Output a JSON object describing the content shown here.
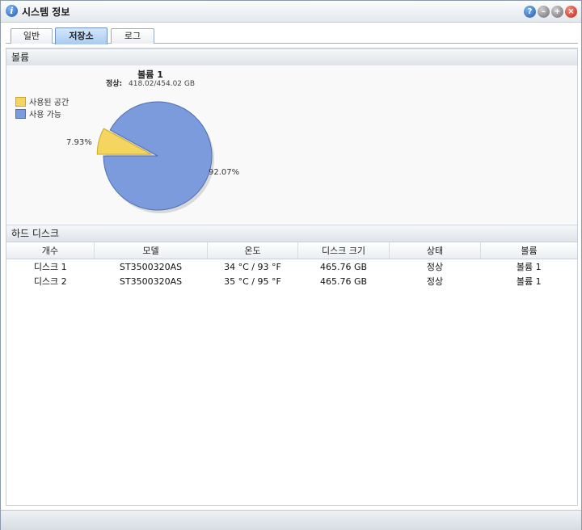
{
  "window": {
    "title": "시스템 정보"
  },
  "tabs": [
    {
      "label": "일반"
    },
    {
      "label": "저장소"
    },
    {
      "label": "로그"
    }
  ],
  "volume_section": {
    "header": "볼륨",
    "volume_title": "볼륨 1",
    "status_label": "정상:",
    "status_value": "418.02/454.02 GB",
    "legend": [
      {
        "label": "사용된 공간",
        "color": "#f4d55f"
      },
      {
        "label": "사용 가능",
        "color": "#7b9bdc"
      }
    ],
    "pie_labels": {
      "used": "7.93%",
      "free": "92.07%"
    }
  },
  "chart_data": {
    "type": "pie",
    "title": "볼륨 1",
    "labels": [
      "사용된 공간",
      "사용 가능"
    ],
    "values": [
      7.93,
      92.07
    ],
    "colors": [
      "#f4d55f",
      "#7b9bdc"
    ]
  },
  "disk_section": {
    "header": "하드 디스크",
    "columns": [
      "개수",
      "모델",
      "온도",
      "디스크 크기",
      "상태",
      "볼륨"
    ],
    "rows": [
      [
        "디스크 1",
        "ST3500320AS",
        "34 °C / 93 °F",
        "465.76 GB",
        "정상",
        "볼륨 1"
      ],
      [
        "디스크 2",
        "ST3500320AS",
        "35 °C / 95 °F",
        "465.76 GB",
        "정상",
        "볼륨 1"
      ]
    ]
  }
}
